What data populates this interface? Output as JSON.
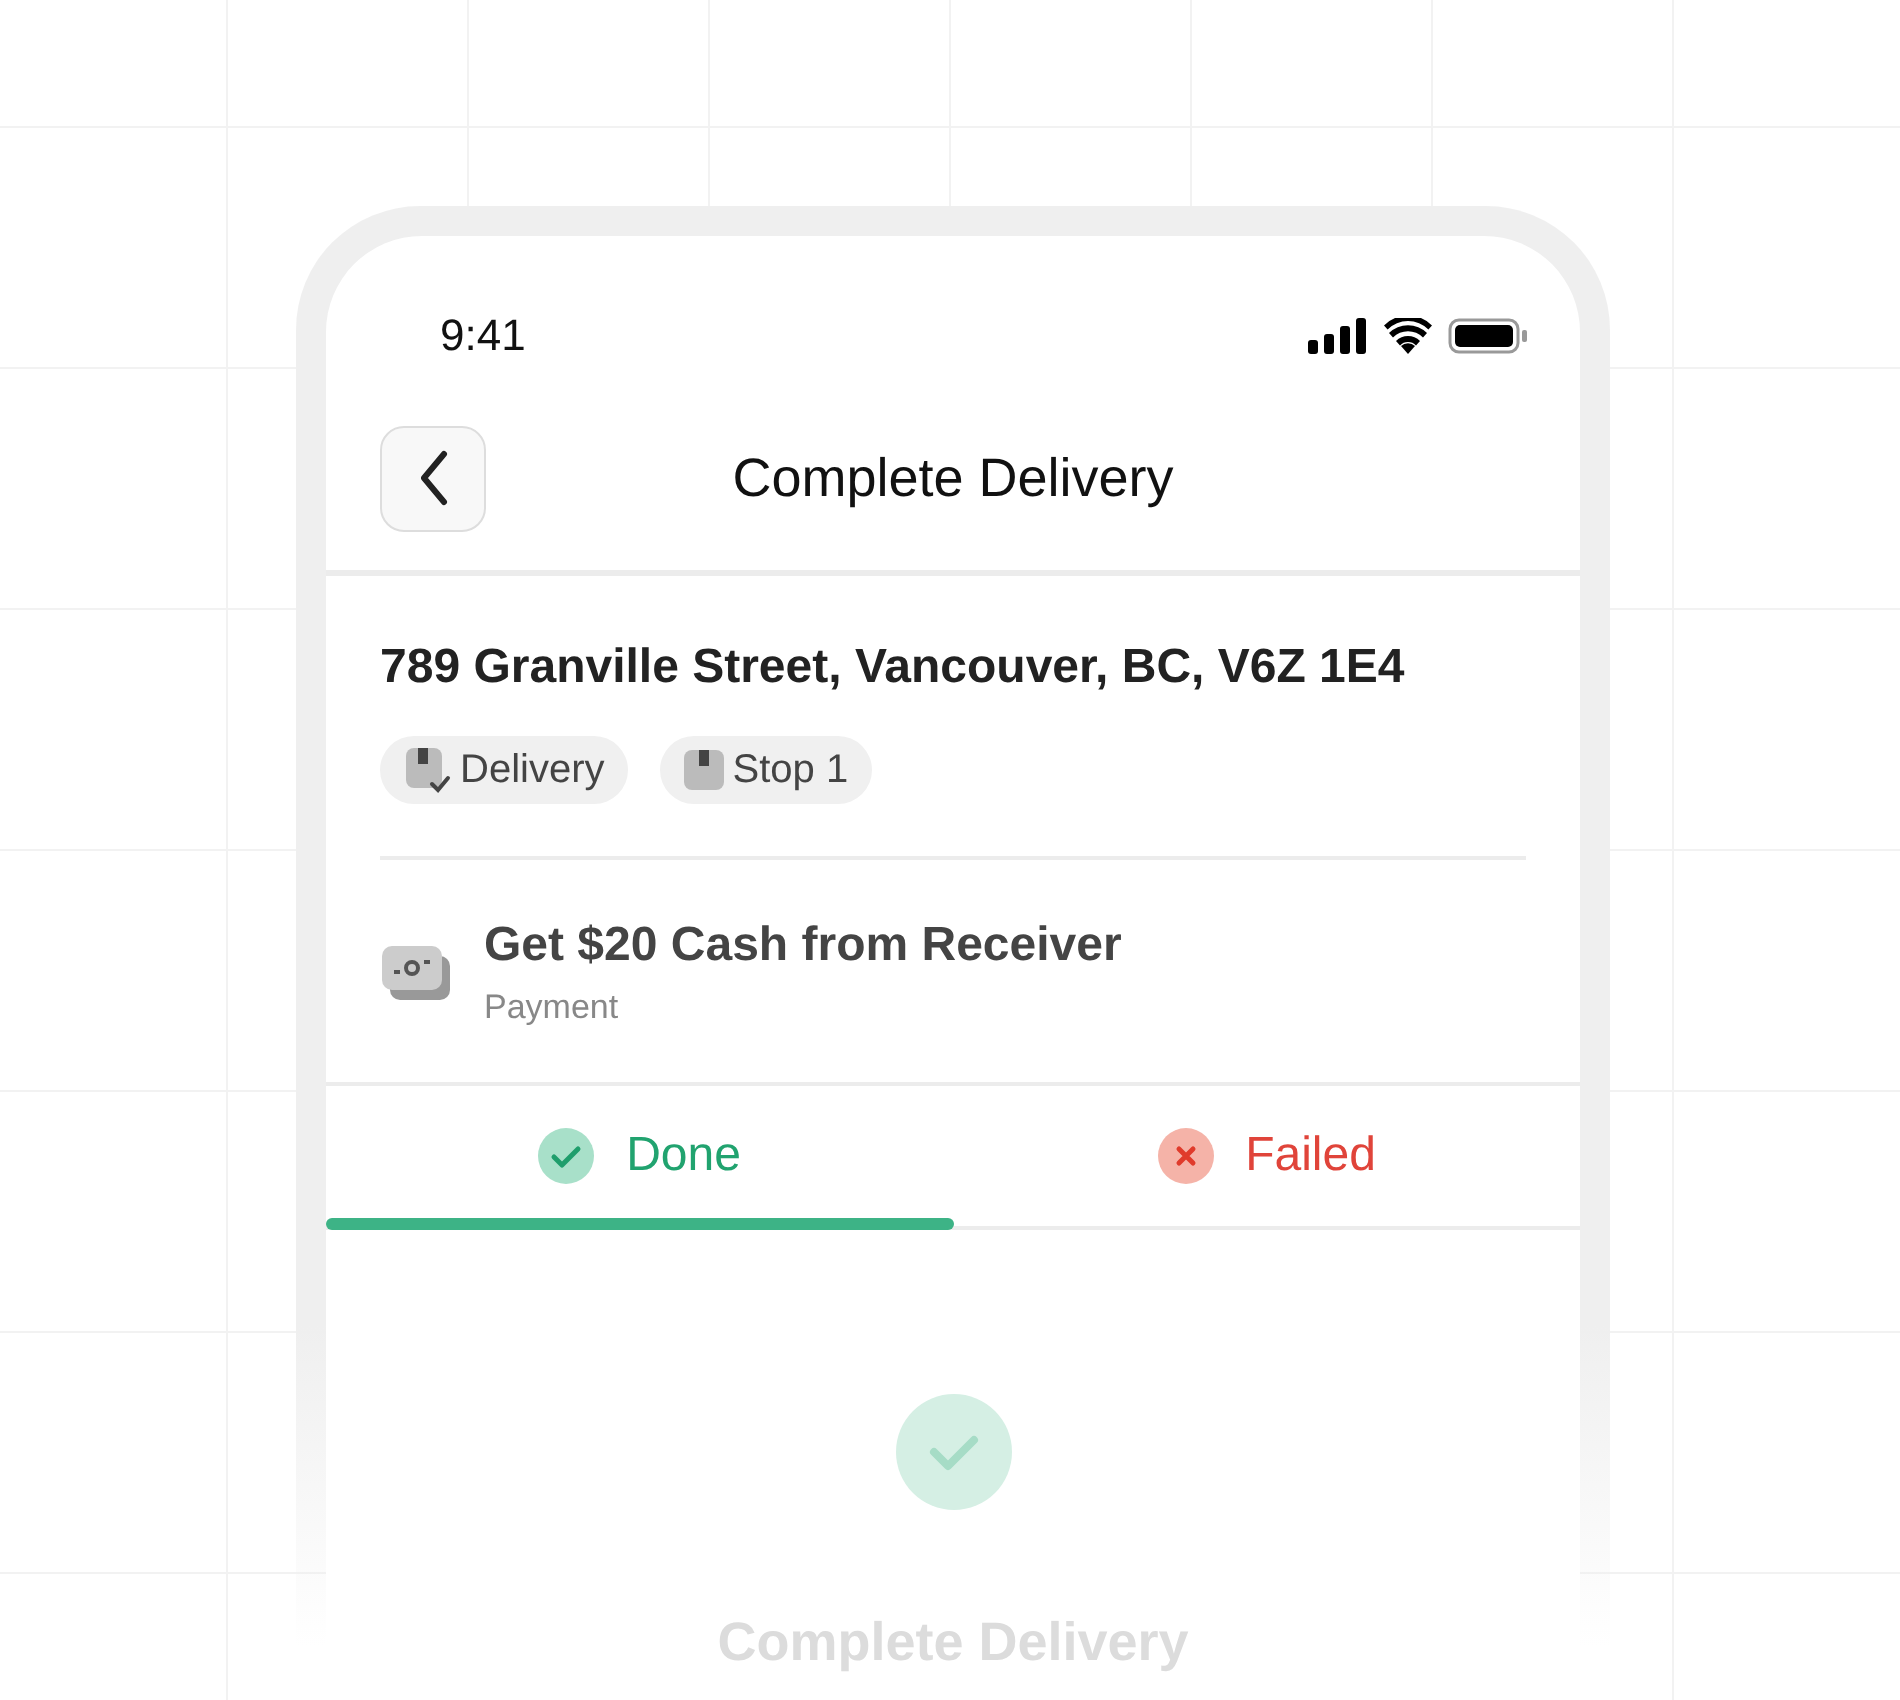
{
  "status_bar": {
    "time": "9:41"
  },
  "header": {
    "title": "Complete Delivery"
  },
  "stop": {
    "address": "789 Granville Street, Vancouver, BC, V6Z 1E4",
    "chips": [
      {
        "label": "Delivery",
        "kind": "delivery"
      },
      {
        "label": "Stop 1",
        "kind": "stop"
      }
    ]
  },
  "task": {
    "title": "Get $20 Cash from Receiver",
    "subtitle": "Payment"
  },
  "tabs": [
    {
      "label": "Done",
      "kind": "done",
      "selected": true
    },
    {
      "label": "Failed",
      "kind": "failed",
      "selected": false
    }
  ],
  "action": {
    "label": "Complete Delivery",
    "disabled": true
  }
}
